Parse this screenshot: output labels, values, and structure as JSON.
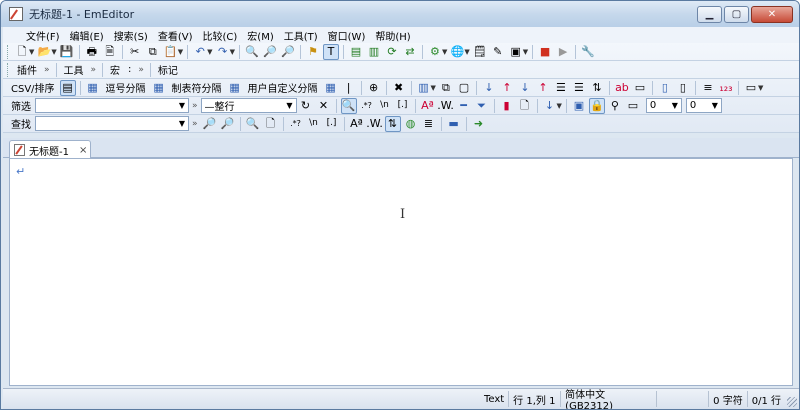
{
  "window": {
    "title": "无标题-1 - EmEditor"
  },
  "menu": [
    "文件(F)",
    "编辑(E)",
    "搜索(S)",
    "查看(V)",
    "比较(C)",
    "宏(M)",
    "工具(T)",
    "窗口(W)",
    "帮助(H)"
  ],
  "toolbar_labels": {
    "plugins": "插件",
    "tools": "工具",
    "macro": "宏",
    "marks": "标记",
    "csv_sort": "CSV/排序",
    "comma_sep": "逗号分隔",
    "tab_sep": "制表符分隔",
    "user_sep": "用户自定义分隔",
    "filter": "筛选",
    "find": "查找",
    "whole_line": "—整行",
    "num_select_1": "0",
    "num_select_2": "0"
  },
  "tab": {
    "label": "无标题-1",
    "close": "×"
  },
  "editor": {
    "eol_mark": "↵"
  },
  "status": {
    "mode": "Text",
    "position": "行 1,列 1",
    "encoding": "简体中文(GB2312)",
    "chars": "0 字符",
    "lines": "0/1 行"
  }
}
